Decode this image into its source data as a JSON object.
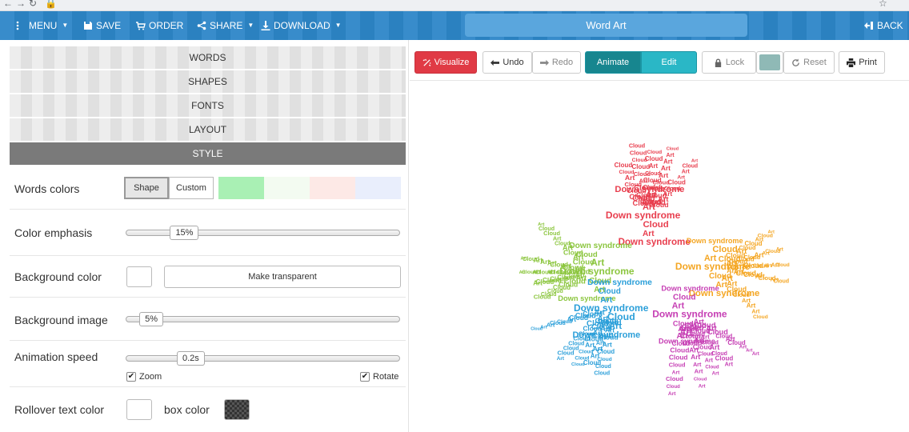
{
  "browser": {
    "back_glyph": "←",
    "forward_glyph": "→",
    "reload_glyph": "↻",
    "lock_glyph": "🔒",
    "star_glyph": "☆"
  },
  "topbar": {
    "menu_label": "MENU",
    "save_label": "SAVE",
    "order_label": "ORDER",
    "share_label": "SHARE",
    "download_label": "DOWNLOAD",
    "title": "Word Art",
    "back_label": "BACK"
  },
  "tabs": {
    "words": "WORDS",
    "shapes": "SHAPES",
    "fonts": "FONTS",
    "layout": "LAYOUT",
    "style": "STYLE"
  },
  "style": {
    "words_colors": {
      "label": "Words colors",
      "shape_label": "Shape",
      "custom_label": "Custom",
      "swatches": [
        "#a9f0b4",
        "#f3fbf1",
        "#fde9e6",
        "#e9eefc"
      ]
    },
    "color_emphasis": {
      "label": "Color emphasis",
      "value_text": "15%",
      "value": 15
    },
    "background_color": {
      "label": "Background color",
      "transparent_label": "Make transparent"
    },
    "background_image": {
      "label": "Background image",
      "value_text": "5%",
      "value": 5
    },
    "animation_speed": {
      "label": "Animation speed",
      "value_text": "0.2s",
      "zoom_label": "Zoom",
      "rotate_label": "Rotate",
      "check_glyph": "✔"
    },
    "rollover": {
      "label": "Rollover text color",
      "box_label": "box color",
      "box_color": "#333333"
    }
  },
  "toolbar": {
    "visualize_label": "Visualize",
    "undo_label": "Undo",
    "redo_label": "Redo",
    "animate_label": "Animate",
    "edit_label": "Edit",
    "lock_label": "Lock",
    "reset_label": "Reset",
    "print_label": "Print",
    "color_swatch": "#8fb9b6"
  },
  "colors": {
    "accent_blue": "#2d86c8",
    "visualize_red": "#e03a45",
    "teal": "#20a6b5"
  },
  "wordart": {
    "words": [
      "Down syndrome",
      "Cloud",
      "Art"
    ],
    "hands": [
      {
        "color": "#e83e4e"
      },
      {
        "color": "#8cc63f"
      },
      {
        "color": "#f4a623"
      },
      {
        "color": "#2b9fd9"
      },
      {
        "color": "#c63fb4"
      }
    ]
  }
}
